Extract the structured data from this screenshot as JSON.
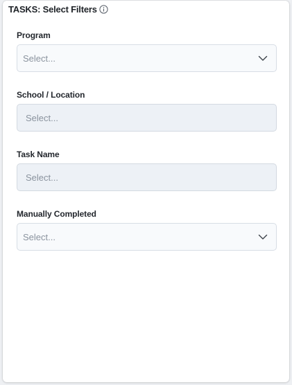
{
  "header": {
    "title": "TASKS: Select Filters",
    "info_icon": "info-circle-icon"
  },
  "filters": [
    {
      "label": "Program",
      "placeholder": "Select...",
      "disabled": false,
      "icon": "chevron-down-icon"
    },
    {
      "label": "School / Location",
      "placeholder": "Select...",
      "disabled": true
    },
    {
      "label": "Task Name",
      "placeholder": "Select...",
      "disabled": true
    },
    {
      "label": "Manually Completed",
      "placeholder": "Select...",
      "disabled": false,
      "icon": "chevron-down-icon"
    }
  ],
  "colors": {
    "enabled_background": "#f8fafc",
    "disabled_background": "#edf1f6",
    "border": "#d7dde5",
    "placeholder_text": "#8a939e",
    "label_text": "#23272d"
  }
}
